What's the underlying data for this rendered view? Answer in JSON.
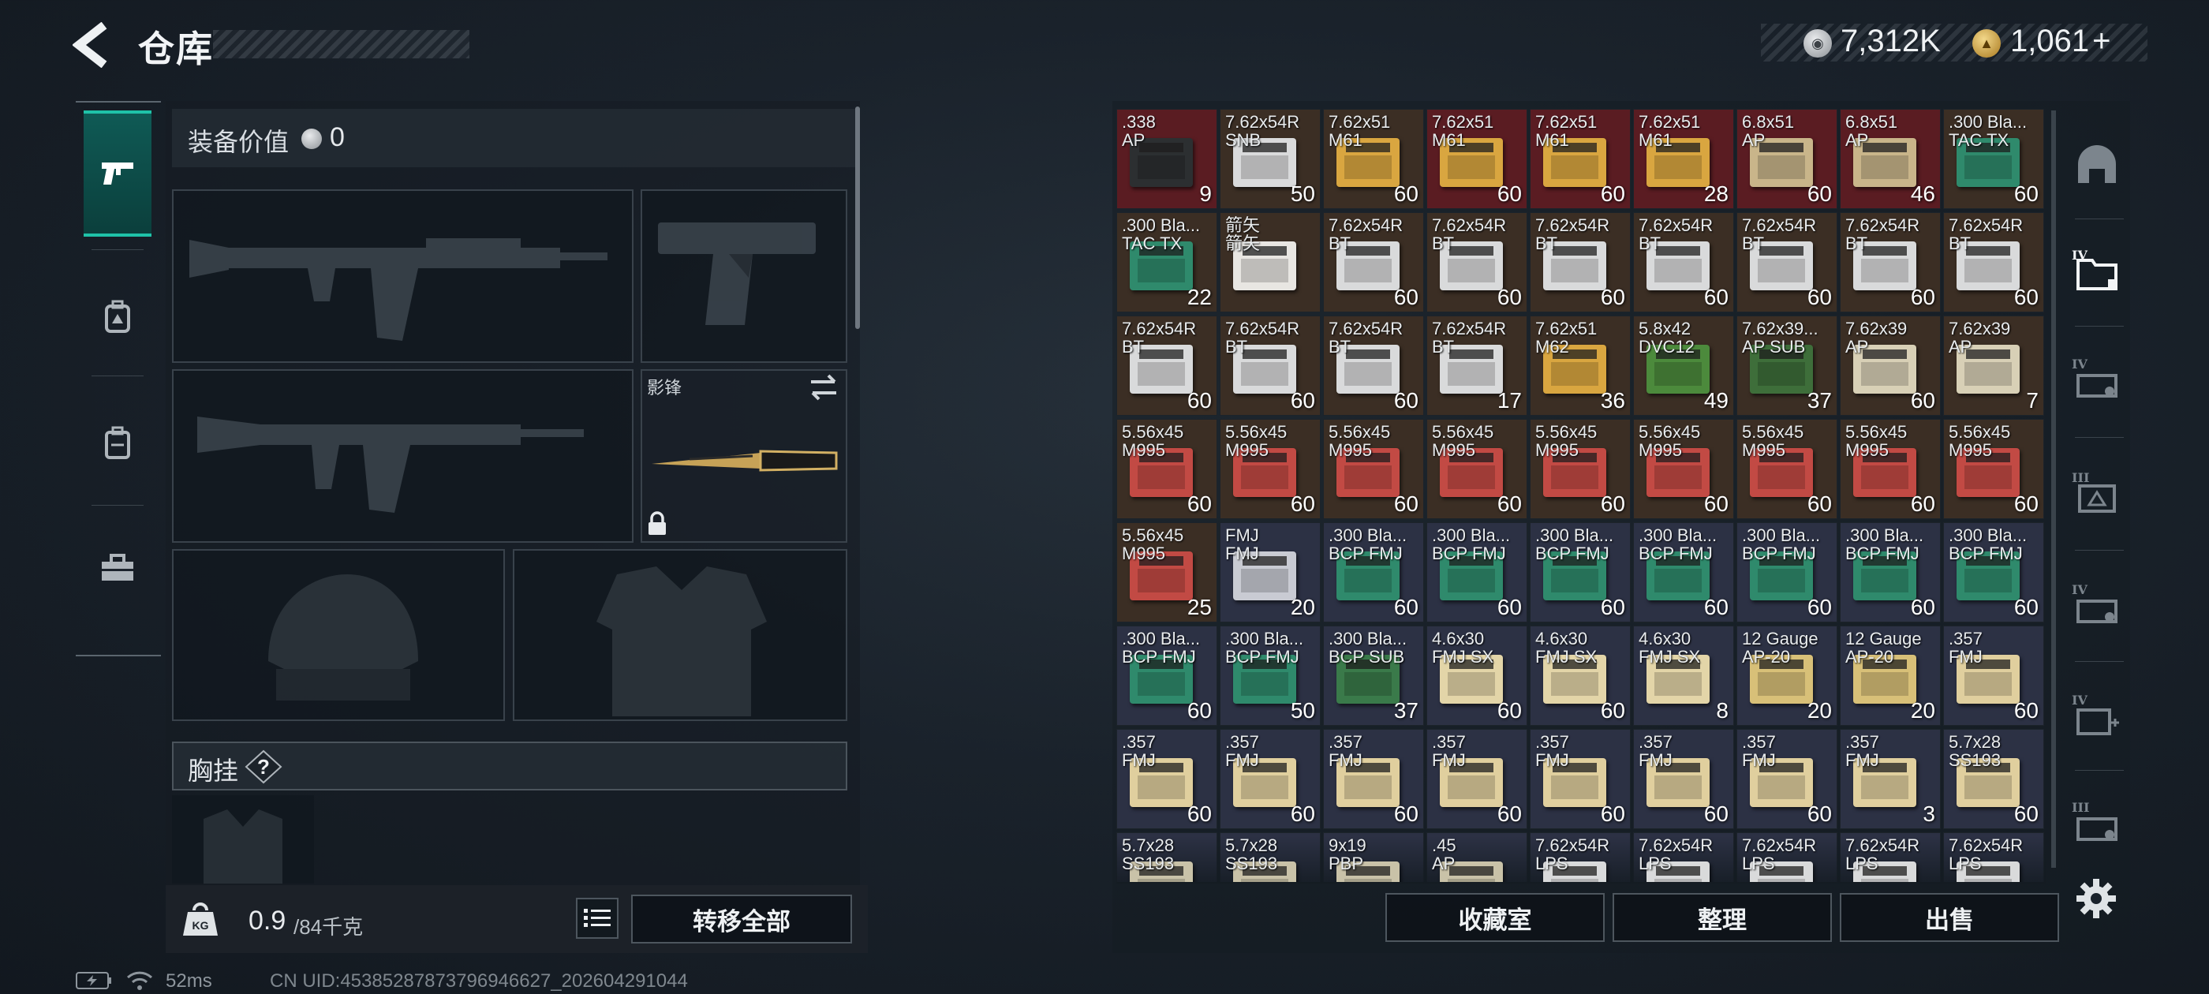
{
  "header": {
    "title": "仓库",
    "silver_amount": "7,312K",
    "gold_amount": "1,061",
    "gold_plus": "+",
    "silver_icon": "silver-coin-icon",
    "gold_icon": "gold-coin-icon"
  },
  "left_categories": [
    {
      "icon": "pistol-icon",
      "active": true
    },
    {
      "icon": "backpack-badge-icon",
      "active": false
    },
    {
      "icon": "backpack-icon",
      "active": false
    },
    {
      "icon": "toolbox-icon",
      "active": false
    }
  ],
  "equipment": {
    "value_label": "装备价值",
    "value": "0",
    "melee_name": "影锋",
    "rig_label": "胸挂",
    "rig_help": "?"
  },
  "weight": {
    "current": "0.9",
    "max": "/84千克"
  },
  "buttons": {
    "transfer_all": "转移全部",
    "vault": "收藏室",
    "sort": "整理",
    "sell": "出售"
  },
  "status": {
    "ping": "52ms",
    "uid": "CN UID:453852878737969466​27_202604291044"
  },
  "stash": {
    "columns": 8,
    "rows": [
      [
        {
          "l1": ".338",
          "l2": "AP",
          "count": "9",
          "bg": "#5a1c22",
          "box": "#2c2f31"
        },
        {
          "l1": "7.62x54R",
          "l2": "SNB",
          "count": "50",
          "bg": "#3b2e24",
          "box": "#d9dadb"
        },
        {
          "l1": "7.62x51",
          "l2": "M61",
          "count": "60",
          "bg": "#3b2e24",
          "box": "#d9a640"
        },
        {
          "l1": "7.62x51",
          "l2": "M61",
          "count": "60",
          "bg": "#5a1c22",
          "box": "#d9a640"
        },
        {
          "l1": "7.62x51",
          "l2": "M61",
          "count": "60",
          "bg": "#5a1c22",
          "box": "#d9a640"
        },
        {
          "l1": "7.62x51",
          "l2": "M61",
          "count": "28",
          "bg": "#5a1c22",
          "box": "#d9a640"
        },
        {
          "l1": "6.8x51",
          "l2": "AP",
          "count": "60",
          "bg": "#5a1c22",
          "box": "#c9b58a"
        },
        {
          "l1": "6.8x51",
          "l2": "AP",
          "count": "46",
          "bg": "#5a1c22",
          "box": "#c9b58a"
        },
        {
          "l1": ".300 Bla...",
          "l2": "TAC TX",
          "count": "60",
          "bg": "#3b2e24",
          "box": "#2f8a6c"
        }
      ],
      [
        {
          "l1": ".300 Bla...",
          "l2": "TAC TX",
          "count": "22",
          "bg": "#3b2e24",
          "box": "#2f8a6c"
        },
        {
          "l1": "箭矢",
          "l2": "箭矢",
          "count": "",
          "bg": "#3b2e24",
          "box": "#e8e6e2"
        },
        {
          "l1": "7.62x54R",
          "l2": "BT",
          "count": "60",
          "bg": "#3b2e24",
          "box": "#d9dadb"
        },
        {
          "l1": "7.62x54R",
          "l2": "BT",
          "count": "60",
          "bg": "#3b2e24",
          "box": "#d9dadb"
        },
        {
          "l1": "7.62x54R",
          "l2": "BT",
          "count": "60",
          "bg": "#3b2e24",
          "box": "#d9dadb"
        },
        {
          "l1": "7.62x54R",
          "l2": "BT",
          "count": "60",
          "bg": "#3b2e24",
          "box": "#d9dadb"
        },
        {
          "l1": "7.62x54R",
          "l2": "BT",
          "count": "60",
          "bg": "#3b2e24",
          "box": "#d9dadb"
        },
        {
          "l1": "7.62x54R",
          "l2": "BT",
          "count": "60",
          "bg": "#3b2e24",
          "box": "#d9dadb"
        },
        {
          "l1": "7.62x54R",
          "l2": "BT",
          "count": "60",
          "bg": "#3b2e24",
          "box": "#d9dadb"
        }
      ],
      [
        {
          "l1": "7.62x54R",
          "l2": "BT",
          "count": "60",
          "bg": "#3b2e24",
          "box": "#d9dadb"
        },
        {
          "l1": "7.62x54R",
          "l2": "BT",
          "count": "60",
          "bg": "#3b2e24",
          "box": "#d9dadb"
        },
        {
          "l1": "7.62x54R",
          "l2": "BT",
          "count": "60",
          "bg": "#3b2e24",
          "box": "#d9dadb"
        },
        {
          "l1": "7.62x54R",
          "l2": "BT",
          "count": "17",
          "bg": "#3b2e24",
          "box": "#d9dadb"
        },
        {
          "l1": "7.62x51",
          "l2": "M62",
          "count": "36",
          "bg": "#3b2e24",
          "box": "#d9a640"
        },
        {
          "l1": "5.8x42",
          "l2": "DVC12",
          "count": "49",
          "bg": "#3b2e24",
          "box": "#4c8a3c"
        },
        {
          "l1": "7.62x39...",
          "l2": "AP SUB",
          "count": "37",
          "bg": "#3b2e24",
          "box": "#3e6e3a"
        },
        {
          "l1": "7.62x39",
          "l2": "AP",
          "count": "60",
          "bg": "#3b2e24",
          "box": "#d8d0b6"
        },
        {
          "l1": "7.62x39",
          "l2": "AP",
          "count": "7",
          "bg": "#3b2e24",
          "box": "#d8d0b6"
        }
      ],
      [
        {
          "l1": "5.56x45",
          "l2": "M995",
          "count": "60",
          "bg": "#3b2e24",
          "box": "#c24a44"
        },
        {
          "l1": "5.56x45",
          "l2": "M995",
          "count": "60",
          "bg": "#3b2e24",
          "box": "#c24a44"
        },
        {
          "l1": "5.56x45",
          "l2": "M995",
          "count": "60",
          "bg": "#3b2e24",
          "box": "#c24a44"
        },
        {
          "l1": "5.56x45",
          "l2": "M995",
          "count": "60",
          "bg": "#3b2e24",
          "box": "#c24a44"
        },
        {
          "l1": "5.56x45",
          "l2": "M995",
          "count": "60",
          "bg": "#3b2e24",
          "box": "#c24a44"
        },
        {
          "l1": "5.56x45",
          "l2": "M995",
          "count": "60",
          "bg": "#3b2e24",
          "box": "#c24a44"
        },
        {
          "l1": "5.56x45",
          "l2": "M995",
          "count": "60",
          "bg": "#3b2e24",
          "box": "#c24a44"
        },
        {
          "l1": "5.56x45",
          "l2": "M995",
          "count": "60",
          "bg": "#3b2e24",
          "box": "#c24a44"
        },
        {
          "l1": "5.56x45",
          "l2": "M995",
          "count": "60",
          "bg": "#3b2e24",
          "box": "#c24a44"
        }
      ],
      [
        {
          "l1": "5.56x45",
          "l2": "M995",
          "count": "25",
          "bg": "#3b2e24",
          "box": "#c24a44"
        },
        {
          "l1": "FMJ",
          "l2": "FMJ",
          "count": "20",
          "bg": "#2c3144",
          "box": "#c9cbd3"
        },
        {
          "l1": ".300 Bla...",
          "l2": "BCP FMJ",
          "count": "60",
          "bg": "#2c3144",
          "box": "#2f8a6c"
        },
        {
          "l1": ".300 Bla...",
          "l2": "BCP FMJ",
          "count": "60",
          "bg": "#2c3144",
          "box": "#2f8a6c"
        },
        {
          "l1": ".300 Bla...",
          "l2": "BCP FMJ",
          "count": "60",
          "bg": "#2c3144",
          "box": "#2f8a6c"
        },
        {
          "l1": ".300 Bla...",
          "l2": "BCP FMJ",
          "count": "60",
          "bg": "#2c3144",
          "box": "#2f8a6c"
        },
        {
          "l1": ".300 Bla...",
          "l2": "BCP FMJ",
          "count": "60",
          "bg": "#2c3144",
          "box": "#2f8a6c"
        },
        {
          "l1": ".300 Bla...",
          "l2": "BCP FMJ",
          "count": "60",
          "bg": "#2c3144",
          "box": "#2f8a6c"
        },
        {
          "l1": ".300 Bla...",
          "l2": "BCP FMJ",
          "count": "60",
          "bg": "#2c3144",
          "box": "#2f8a6c"
        }
      ],
      [
        {
          "l1": ".300 Bla...",
          "l2": "BCP FMJ",
          "count": "60",
          "bg": "#2c3144",
          "box": "#2f8a6c"
        },
        {
          "l1": ".300 Bla...",
          "l2": "BCP FMJ",
          "count": "50",
          "bg": "#2c3144",
          "box": "#2f8a6c"
        },
        {
          "l1": ".300 Bla...",
          "l2": "BCP SUB",
          "count": "37",
          "bg": "#2c3144",
          "box": "#3a7a4a"
        },
        {
          "l1": "4.6x30",
          "l2": "FMJ SX",
          "count": "60",
          "bg": "#2c3144",
          "box": "#e3d5a8"
        },
        {
          "l1": "4.6x30",
          "l2": "FMJ SX",
          "count": "60",
          "bg": "#2c3144",
          "box": "#e3d5a8"
        },
        {
          "l1": "4.6x30",
          "l2": "FMJ SX",
          "count": "8",
          "bg": "#2c3144",
          "box": "#e3d5a8"
        },
        {
          "l1": "12 Gauge",
          "l2": "AP-20",
          "count": "20",
          "bg": "#2c3144",
          "box": "#d8c078"
        },
        {
          "l1": "12 Gauge",
          "l2": "AP-20",
          "count": "20",
          "bg": "#2c3144",
          "box": "#d8c078"
        },
        {
          "l1": ".357",
          "l2": "FMJ",
          "count": "60",
          "bg": "#2c3144",
          "box": "#e0cf9e"
        }
      ],
      [
        {
          "l1": ".357",
          "l2": "FMJ",
          "count": "60",
          "bg": "#2c3144",
          "box": "#e0cf9e"
        },
        {
          "l1": ".357",
          "l2": "FMJ",
          "count": "60",
          "bg": "#2c3144",
          "box": "#e0cf9e"
        },
        {
          "l1": ".357",
          "l2": "FMJ",
          "count": "60",
          "bg": "#2c3144",
          "box": "#e0cf9e"
        },
        {
          "l1": ".357",
          "l2": "FMJ",
          "count": "60",
          "bg": "#2c3144",
          "box": "#e0cf9e"
        },
        {
          "l1": ".357",
          "l2": "FMJ",
          "count": "60",
          "bg": "#2c3144",
          "box": "#e0cf9e"
        },
        {
          "l1": ".357",
          "l2": "FMJ",
          "count": "60",
          "bg": "#2c3144",
          "box": "#e0cf9e"
        },
        {
          "l1": ".357",
          "l2": "FMJ",
          "count": "60",
          "bg": "#2c3144",
          "box": "#e0cf9e"
        },
        {
          "l1": ".357",
          "l2": "FMJ",
          "count": "3",
          "bg": "#2c3144",
          "box": "#e0cf9e"
        },
        {
          "l1": "5.7x28",
          "l2": "SS193",
          "count": "60",
          "bg": "#2c3144",
          "box": "#e0cf9e"
        }
      ],
      [
        {
          "l1": "5.7x28",
          "l2": "SS193",
          "count": "",
          "bg": "#2c3144",
          "box": "#c9c2a8"
        },
        {
          "l1": "5.7x28",
          "l2": "SS193",
          "count": "",
          "bg": "#2c3144",
          "box": "#c9c2a8"
        },
        {
          "l1": "9x19",
          "l2": "PBP",
          "count": "",
          "bg": "#2c3144",
          "box": "#c9c2a8"
        },
        {
          "l1": ".45",
          "l2": "AP",
          "count": "",
          "bg": "#2c3144",
          "box": "#c9c2a8"
        },
        {
          "l1": "7.62x54R",
          "l2": "LPS",
          "count": "",
          "bg": "#2c3144",
          "box": "#d9dadb"
        },
        {
          "l1": "7.62x54R",
          "l2": "LPS",
          "count": "",
          "bg": "#2c3144",
          "box": "#d9dadb"
        },
        {
          "l1": "7.62x54R",
          "l2": "LPS",
          "count": "",
          "bg": "#2c3144",
          "box": "#d9dadb"
        },
        {
          "l1": "7.62x54R",
          "l2": "LPS",
          "count": "",
          "bg": "#2c3144",
          "box": "#d9dadb"
        },
        {
          "l1": "7.62x54R",
          "l2": "LPS",
          "count": "",
          "bg": "#2c3144",
          "box": "#d9dadb"
        }
      ]
    ]
  },
  "right_tabs": [
    {
      "icon": "helmet-tab-icon",
      "tier": ""
    },
    {
      "icon": "folder-tier-icon",
      "tier": "IV"
    },
    {
      "icon": "case-tier-icon",
      "tier": "IV"
    },
    {
      "icon": "box-tier-icon",
      "tier": "III"
    },
    {
      "icon": "case-tier-icon",
      "tier": "IV"
    },
    {
      "icon": "medkit-tier-icon",
      "tier": "IV"
    },
    {
      "icon": "case-tier-icon",
      "tier": "III"
    }
  ]
}
